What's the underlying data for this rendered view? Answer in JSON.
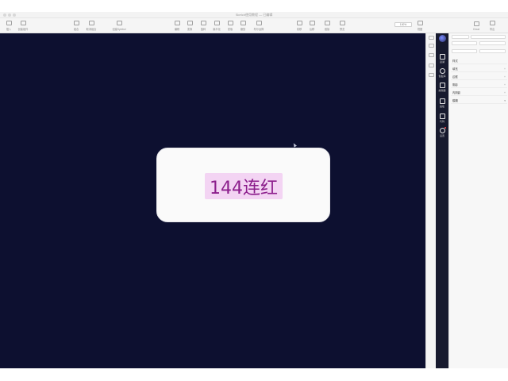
{
  "window": {
    "title": "Sketch使用教程 — 已编辑"
  },
  "toolbar": {
    "items": [
      {
        "label": "插入",
        "icon": "plus-icon"
      },
      {
        "label": "创建组件",
        "icon": "component-icon"
      },
      {
        "label": "组合",
        "icon": "group-icon"
      },
      {
        "label": "取消组合",
        "icon": "ungroup-icon"
      },
      {
        "label": "创建Symbol",
        "icon": "symbol-icon"
      },
      {
        "label": "编辑",
        "icon": "edit-icon"
      },
      {
        "label": "变换",
        "icon": "transform-icon"
      },
      {
        "label": "旋转",
        "icon": "rotate-icon"
      },
      {
        "label": "扁平化",
        "icon": "flatten-icon"
      },
      {
        "label": "蒙版",
        "icon": "mask-icon"
      },
      {
        "label": "缩放",
        "icon": "scale-icon"
      },
      {
        "label": "布尔运算",
        "icon": "boolean-icon"
      },
      {
        "label": "前移",
        "icon": "forward-icon"
      },
      {
        "label": "后移",
        "icon": "backward-icon"
      },
      {
        "label": "链接",
        "icon": "link-icon"
      },
      {
        "label": "预览",
        "icon": "preview-icon"
      },
      {
        "label": "Cloud",
        "icon": "cloud-icon"
      },
      {
        "label": "导出",
        "icon": "export-icon"
      }
    ],
    "zoom": "100%",
    "view_label": "视图"
  },
  "canvas": {
    "card_text": "144连红",
    "background": "#0d1030",
    "tag_background": "#f3d4f3",
    "tag_color": "#8c1e8c"
  },
  "plugins": {
    "items": [
      {
        "label": "蓝湖",
        "icon": "grid-icon"
      },
      {
        "label": "色板库",
        "icon": "palette-icon"
      },
      {
        "label": "编辑器",
        "icon": "editor-icon"
      },
      {
        "label": "画板",
        "icon": "artboard-icon"
      },
      {
        "label": "代码",
        "icon": "code-icon"
      },
      {
        "label": "设置",
        "icon": "settings-icon"
      }
    ]
  },
  "properties": {
    "sections": [
      {
        "label": "样式"
      },
      {
        "label": "填充"
      },
      {
        "label": "边框"
      },
      {
        "label": "阴影"
      },
      {
        "label": "内阴影"
      },
      {
        "label": "模糊"
      }
    ]
  }
}
